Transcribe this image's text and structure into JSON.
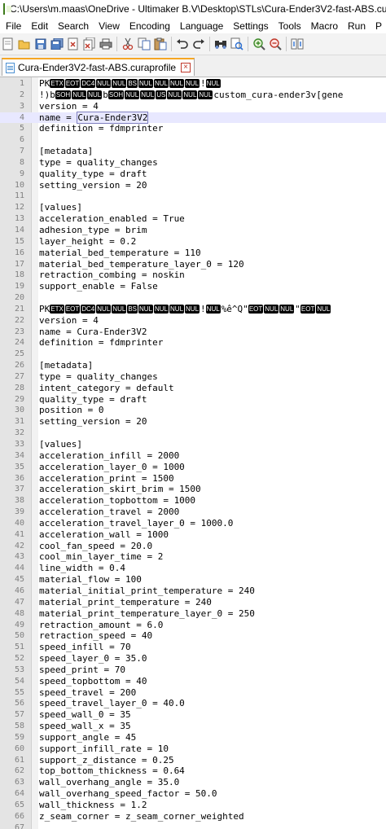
{
  "window": {
    "title": "C:\\Users\\m.maas\\OneDrive - Ultimaker B.V\\Desktop\\STLs\\Cura-Ender3V2-fast-ABS.cur"
  },
  "menu": [
    "File",
    "Edit",
    "Search",
    "View",
    "Encoding",
    "Language",
    "Settings",
    "Tools",
    "Macro",
    "Run",
    "P"
  ],
  "toolbar": {
    "icons": [
      "new-file-icon",
      "open-file-icon",
      "save-icon",
      "save-all-icon",
      "close-icon",
      "close-all-icon",
      "print-icon",
      "cut-icon",
      "copy-icon",
      "paste-icon",
      "undo-icon",
      "redo-icon",
      "find-icon",
      "replace-icon",
      "zoom-in-icon",
      "zoom-out-icon",
      "sync-icon",
      "wrap-icon"
    ]
  },
  "tab": {
    "label": "Cura-Ender3V2-fast-ABS.curaprofile",
    "close": "×"
  },
  "lines": [
    {
      "n": "1",
      "segs": [
        {
          "t": "PK"
        },
        {
          "c": "ETX"
        },
        {
          "c": "EOT"
        },
        {
          "c": "DC4"
        },
        {
          "c": "NUL"
        },
        {
          "c": "NUL"
        },
        {
          "c": "BS"
        },
        {
          "c": "NUL"
        },
        {
          "c": "NUL"
        },
        {
          "c": "NUL"
        },
        {
          "c": "NUL"
        },
        {
          "t": "!"
        },
        {
          "c": "NUL"
        }
      ]
    },
    {
      "n": "2",
      "segs": [
        {
          "t": "!)b"
        },
        {
          "c": "SOH"
        },
        {
          "c": "NUL"
        },
        {
          "c": "NUL"
        },
        {
          "t": "b"
        },
        {
          "c": "SOH"
        },
        {
          "c": "NUL"
        },
        {
          "c": "NUL"
        },
        {
          "c": "US"
        },
        {
          "c": "NUL"
        },
        {
          "c": "NUL"
        },
        {
          "c": "NUL"
        },
        {
          "t": "custom_cura-ender3v[gene"
        }
      ]
    },
    {
      "n": "3",
      "segs": [
        {
          "t": "version = 4"
        }
      ]
    },
    {
      "n": "4",
      "current": true,
      "segs": [
        {
          "t": "name = "
        },
        {
          "s": "Cura-Ender3V2"
        }
      ]
    },
    {
      "n": "5",
      "segs": [
        {
          "t": "definition = fdmprinter"
        }
      ]
    },
    {
      "n": "6",
      "segs": [
        {
          "t": ""
        }
      ]
    },
    {
      "n": "7",
      "segs": [
        {
          "t": "[metadata]"
        }
      ]
    },
    {
      "n": "8",
      "segs": [
        {
          "t": "type = quality_changes"
        }
      ]
    },
    {
      "n": "9",
      "segs": [
        {
          "t": "quality_type = draft"
        }
      ]
    },
    {
      "n": "10",
      "segs": [
        {
          "t": "setting_version = 20"
        }
      ]
    },
    {
      "n": "11",
      "segs": [
        {
          "t": ""
        }
      ]
    },
    {
      "n": "12",
      "segs": [
        {
          "t": "[values]"
        }
      ]
    },
    {
      "n": "13",
      "segs": [
        {
          "t": "acceleration_enabled = True"
        }
      ]
    },
    {
      "n": "14",
      "segs": [
        {
          "t": "adhesion_type = brim"
        }
      ]
    },
    {
      "n": "15",
      "segs": [
        {
          "t": "layer_height = 0.2"
        }
      ]
    },
    {
      "n": "16",
      "segs": [
        {
          "t": "material_bed_temperature = 110"
        }
      ]
    },
    {
      "n": "17",
      "segs": [
        {
          "t": "material_bed_temperature_layer_0 = 120"
        }
      ]
    },
    {
      "n": "18",
      "segs": [
        {
          "t": "retraction_combing = noskin"
        }
      ]
    },
    {
      "n": "19",
      "segs": [
        {
          "t": "support_enable = False"
        }
      ]
    },
    {
      "n": "20",
      "segs": [
        {
          "t": ""
        }
      ]
    },
    {
      "n": "21",
      "segs": [
        {
          "t": "PK"
        },
        {
          "c": "ETX"
        },
        {
          "c": "EOT"
        },
        {
          "c": "DC4"
        },
        {
          "c": "NUL"
        },
        {
          "c": "NUL"
        },
        {
          "c": "BS"
        },
        {
          "c": "NUL"
        },
        {
          "c": "NUL"
        },
        {
          "c": "NUL"
        },
        {
          "c": "NUL"
        },
        {
          "t": "!"
        },
        {
          "c": "NUL"
        },
        {
          "t": "%ê^Q\""
        },
        {
          "c": "EOT"
        },
        {
          "c": "NUL"
        },
        {
          "c": "NUL"
        },
        {
          "t": "\""
        },
        {
          "c": "EOT"
        },
        {
          "c": "NUL"
        }
      ]
    },
    {
      "n": "22",
      "segs": [
        {
          "t": "version = 4"
        }
      ]
    },
    {
      "n": "23",
      "segs": [
        {
          "t": "name = Cura-Ender3V2"
        }
      ]
    },
    {
      "n": "24",
      "segs": [
        {
          "t": "definition = fdmprinter"
        }
      ]
    },
    {
      "n": "25",
      "segs": [
        {
          "t": ""
        }
      ]
    },
    {
      "n": "26",
      "segs": [
        {
          "t": "[metadata]"
        }
      ]
    },
    {
      "n": "27",
      "segs": [
        {
          "t": "type = quality_changes"
        }
      ]
    },
    {
      "n": "28",
      "segs": [
        {
          "t": "intent_category = default"
        }
      ]
    },
    {
      "n": "29",
      "segs": [
        {
          "t": "quality_type = draft"
        }
      ]
    },
    {
      "n": "30",
      "segs": [
        {
          "t": "position = 0"
        }
      ]
    },
    {
      "n": "31",
      "segs": [
        {
          "t": "setting_version = 20"
        }
      ]
    },
    {
      "n": "32",
      "segs": [
        {
          "t": ""
        }
      ]
    },
    {
      "n": "33",
      "segs": [
        {
          "t": "[values]"
        }
      ]
    },
    {
      "n": "34",
      "segs": [
        {
          "t": "acceleration_infill = 2000"
        }
      ]
    },
    {
      "n": "35",
      "segs": [
        {
          "t": "acceleration_layer_0 = 1000"
        }
      ]
    },
    {
      "n": "36",
      "segs": [
        {
          "t": "acceleration_print = 1500"
        }
      ]
    },
    {
      "n": "37",
      "segs": [
        {
          "t": "acceleration_skirt_brim = 1500"
        }
      ]
    },
    {
      "n": "38",
      "segs": [
        {
          "t": "acceleration_topbottom = 1000"
        }
      ]
    },
    {
      "n": "39",
      "segs": [
        {
          "t": "acceleration_travel = 2000"
        }
      ]
    },
    {
      "n": "40",
      "segs": [
        {
          "t": "acceleration_travel_layer_0 = 1000.0"
        }
      ]
    },
    {
      "n": "41",
      "segs": [
        {
          "t": "acceleration_wall = 1000"
        }
      ]
    },
    {
      "n": "42",
      "segs": [
        {
          "t": "cool_fan_speed = 20.0"
        }
      ]
    },
    {
      "n": "43",
      "segs": [
        {
          "t": "cool_min_layer_time = 2"
        }
      ]
    },
    {
      "n": "44",
      "segs": [
        {
          "t": "line_width = 0.4"
        }
      ]
    },
    {
      "n": "45",
      "segs": [
        {
          "t": "material_flow = 100"
        }
      ]
    },
    {
      "n": "46",
      "segs": [
        {
          "t": "material_initial_print_temperature = 240"
        }
      ]
    },
    {
      "n": "47",
      "segs": [
        {
          "t": "material_print_temperature = 240"
        }
      ]
    },
    {
      "n": "48",
      "segs": [
        {
          "t": "material_print_temperature_layer_0 = 250"
        }
      ]
    },
    {
      "n": "49",
      "segs": [
        {
          "t": "retraction_amount = 6.0"
        }
      ]
    },
    {
      "n": "50",
      "segs": [
        {
          "t": "retraction_speed = 40"
        }
      ]
    },
    {
      "n": "51",
      "segs": [
        {
          "t": "speed_infill = 70"
        }
      ]
    },
    {
      "n": "52",
      "segs": [
        {
          "t": "speed_layer_0 = 35.0"
        }
      ]
    },
    {
      "n": "53",
      "segs": [
        {
          "t": "speed_print = 70"
        }
      ]
    },
    {
      "n": "54",
      "segs": [
        {
          "t": "speed_topbottom = 40"
        }
      ]
    },
    {
      "n": "55",
      "segs": [
        {
          "t": "speed_travel = 200"
        }
      ]
    },
    {
      "n": "56",
      "segs": [
        {
          "t": "speed_travel_layer_0 = 40.0"
        }
      ]
    },
    {
      "n": "57",
      "segs": [
        {
          "t": "speed_wall_0 = 35"
        }
      ]
    },
    {
      "n": "58",
      "segs": [
        {
          "t": "speed_wall_x = 35"
        }
      ]
    },
    {
      "n": "59",
      "segs": [
        {
          "t": "support_angle = 45"
        }
      ]
    },
    {
      "n": "60",
      "segs": [
        {
          "t": "support_infill_rate = 10"
        }
      ]
    },
    {
      "n": "61",
      "segs": [
        {
          "t": "support_z_distance = 0.25"
        }
      ]
    },
    {
      "n": "62",
      "segs": [
        {
          "t": "top_bottom_thickness = 0.64"
        }
      ]
    },
    {
      "n": "63",
      "segs": [
        {
          "t": "wall_overhang_angle = 35.0"
        }
      ]
    },
    {
      "n": "64",
      "segs": [
        {
          "t": "wall_overhang_speed_factor = 50.0"
        }
      ]
    },
    {
      "n": "65",
      "segs": [
        {
          "t": "wall_thickness = 1.2"
        }
      ]
    },
    {
      "n": "66",
      "segs": [
        {
          "t": "z_seam_corner = z_seam_corner_weighted"
        }
      ]
    },
    {
      "n": "67",
      "segs": [
        {
          "t": ""
        }
      ]
    }
  ]
}
